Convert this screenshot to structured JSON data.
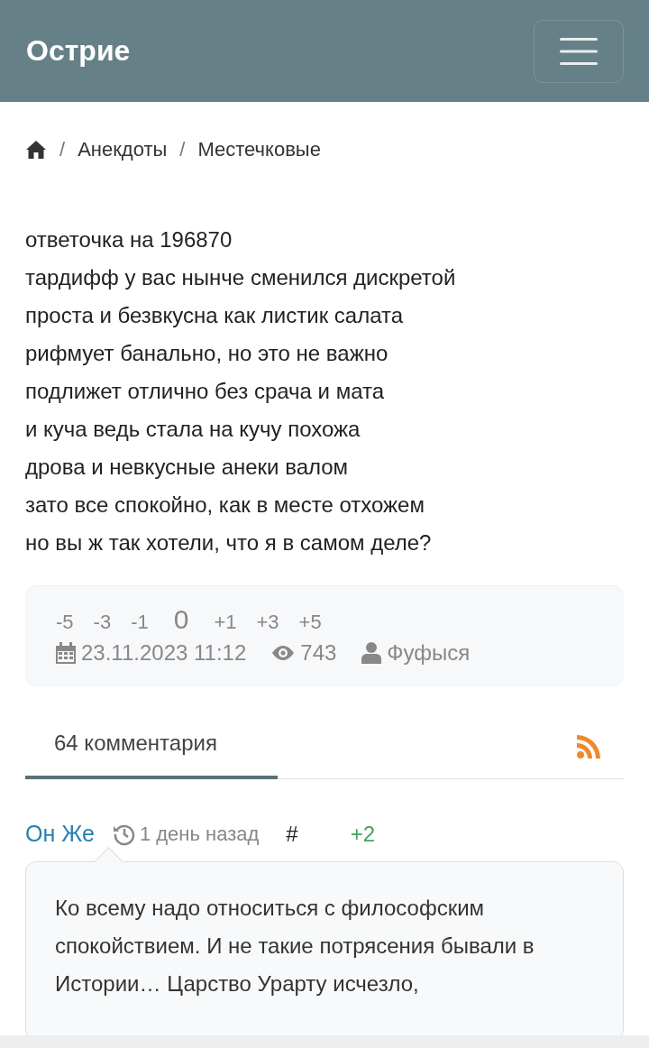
{
  "header": {
    "title": "Острие"
  },
  "breadcrumb": [
    {
      "separator": "/",
      "label": "Анекдоты"
    },
    {
      "separator": "/",
      "label": "Местечковые"
    }
  ],
  "post": {
    "lines": [
      "ответочка на 196870",
      "тардифф у вас нынче сменился дискретой",
      "проста и безвкусна как листик салата",
      "рифмует банально, но это не важно",
      "подлижет отлично без срача и мата",
      "и куча ведь стала на кучу похожа",
      "дрова и невкусные анеки валом",
      "зато все спокойно, как в месте отхожем",
      "но вы ж так хотели, что я в самом деле?"
    ]
  },
  "votes": [
    {
      "label": "-5",
      "kind": "vote"
    },
    {
      "label": "-3",
      "kind": "vote"
    },
    {
      "label": "-1",
      "kind": "vote"
    },
    {
      "label": "0",
      "kind": "score"
    },
    {
      "label": "+1",
      "kind": "vote"
    },
    {
      "label": "+3",
      "kind": "vote"
    },
    {
      "label": "+5",
      "kind": "vote"
    }
  ],
  "meta": {
    "date": "23.11.2023 11:12",
    "views": "743",
    "author": "Фуфыся"
  },
  "comments_tab": {
    "label": "64 комментария",
    "selected": true
  },
  "comments": [
    {
      "author": "Он Же",
      "time": "1 день назад",
      "anchor": "#",
      "score": "+2",
      "text": "Ко всему надо относиться с философским спокойствием. И не такие потрясения бывали в Истории… Царство Урарту исчезло,"
    }
  ]
}
